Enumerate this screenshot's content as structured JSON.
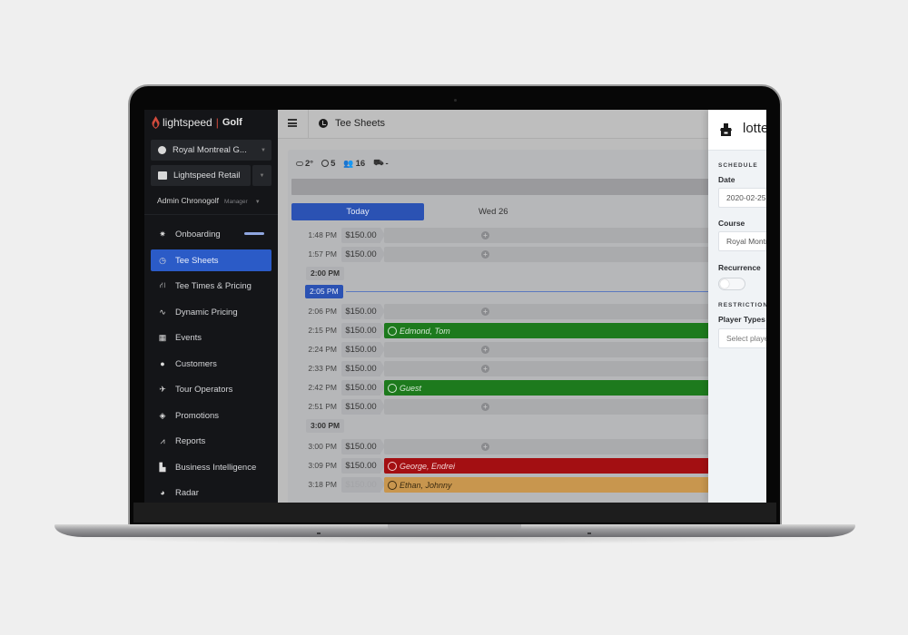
{
  "sidebar": {
    "logo": {
      "brand": "lightspeed",
      "product": "Golf"
    },
    "course_selector": {
      "label": "Royal Montreal G...",
      "icon": "golf-ball-icon"
    },
    "store_selector": {
      "label": "Lightspeed Retail",
      "icon": "register-icon"
    },
    "user": {
      "name": "Admin Chronogolf",
      "role": "Manager"
    },
    "items": [
      {
        "label": "Onboarding",
        "icon": "sparkle-icon",
        "progress_percent": 85
      },
      {
        "label": "Tee Sheets",
        "icon": "clock-icon",
        "active": true
      },
      {
        "label": "Tee Times & Pricing",
        "icon": "road-icon"
      },
      {
        "label": "Dynamic Pricing",
        "icon": "pulse-icon"
      },
      {
        "label": "Events",
        "icon": "calendar-icon"
      },
      {
        "label": "Customers",
        "icon": "user-circle-icon"
      },
      {
        "label": "Tour Operators",
        "icon": "plane-icon"
      },
      {
        "label": "Promotions",
        "icon": "tag-icon"
      },
      {
        "label": "Reports",
        "icon": "chart-line-icon"
      },
      {
        "label": "Business Intelligence",
        "icon": "industry-icon"
      },
      {
        "label": "Radar",
        "icon": "pie-icon"
      }
    ]
  },
  "topbar": {
    "title": "Tee Sheets"
  },
  "stats": {
    "temperature": "2°",
    "rounds": "5",
    "players": "16",
    "carts": "-"
  },
  "day_tabs": {
    "today": "Today",
    "next": "Wed 26"
  },
  "tee_sheet": {
    "rows": [
      {
        "type": "slot",
        "time": "1:48 PM",
        "price": "$150.00"
      },
      {
        "type": "slot",
        "time": "1:57 PM",
        "price": "$150.00"
      },
      {
        "type": "hour",
        "time": "2:00 PM"
      },
      {
        "type": "now",
        "time": "2:05 PM"
      },
      {
        "type": "slot",
        "time": "2:06 PM",
        "price": "$150.00"
      },
      {
        "type": "booking",
        "time": "2:15 PM",
        "price": "$150.00",
        "name": "Edmond, Tom",
        "status": "green"
      },
      {
        "type": "slot",
        "time": "2:24 PM",
        "price": "$150.00"
      },
      {
        "type": "slot",
        "time": "2:33 PM",
        "price": "$150.00"
      },
      {
        "type": "booking",
        "time": "2:42 PM",
        "price": "$150.00",
        "name": "Guest",
        "status": "green"
      },
      {
        "type": "slot",
        "time": "2:51 PM",
        "price": "$150.00"
      },
      {
        "type": "hour",
        "time": "3:00 PM"
      },
      {
        "type": "slot",
        "time": "3:00 PM",
        "price": "$150.00"
      },
      {
        "type": "booking",
        "time": "3:09 PM",
        "price": "$150.00",
        "name": "George, Endrei",
        "status": "red"
      },
      {
        "type": "booking",
        "time": "3:18 PM",
        "price": "$150.00",
        "name": "Ethan, Johnny",
        "status": "orange",
        "price_faded": true
      }
    ],
    "status_colors": {
      "green": "#1d7a1d",
      "red": "#a30f12",
      "orange": "#c8964e"
    }
  },
  "lottery_panel": {
    "title": "lottery",
    "schedule_heading": "SCHEDULE",
    "date_label": "Date",
    "date_value": "2020-02-25",
    "course_label": "Course",
    "course_value": "Royal Montreal Golf Club",
    "recurrence_label": "Recurrence",
    "recurrence_on": false,
    "restrictions_heading": "RESTRICTIONS",
    "player_types_label": "Player Types",
    "player_types_placeholder": "Select player types"
  },
  "colors": {
    "accent": "#2b5bc7",
    "sidebar_bg": "#141518",
    "brand_red": "#d24b3c"
  }
}
